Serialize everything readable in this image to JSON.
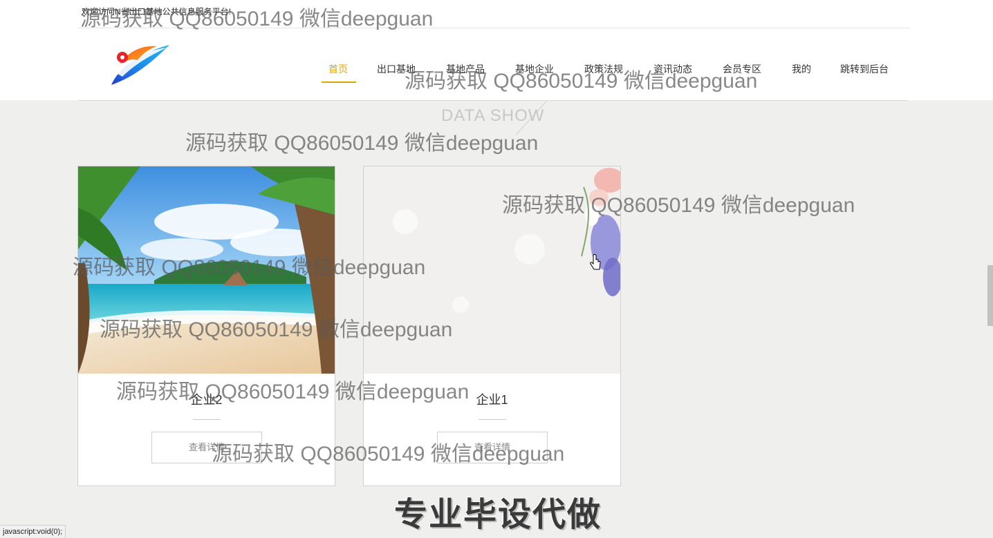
{
  "header": {
    "welcome_text": "欢迎访问N省出口基地公共信息服务平台!",
    "nav": [
      {
        "label": "首页",
        "active": true
      },
      {
        "label": "出口基地",
        "active": false
      },
      {
        "label": "基地产品",
        "active": false
      },
      {
        "label": "基地企业",
        "active": false
      },
      {
        "label": "政策法规",
        "active": false
      },
      {
        "label": "资讯动态",
        "active": false
      },
      {
        "label": "会员专区",
        "active": false
      },
      {
        "label": "我的",
        "active": false
      },
      {
        "label": "跳转到后台",
        "active": false
      }
    ],
    "accent_color": "#e0a400"
  },
  "section": {
    "title": "DATA SHOW"
  },
  "cards": [
    {
      "name": "企业2",
      "button_label": "查看详情",
      "image": "beach-palm-trees"
    },
    {
      "name": "企业1",
      "button_label": "查看详情",
      "image": "flowers-light-background"
    }
  ],
  "banner": {
    "text": "专业毕设代做"
  },
  "status_bar": {
    "text": "javascript:void(0);"
  },
  "watermark": {
    "text": "源码获取 QQ86050149 微信deepguan"
  }
}
